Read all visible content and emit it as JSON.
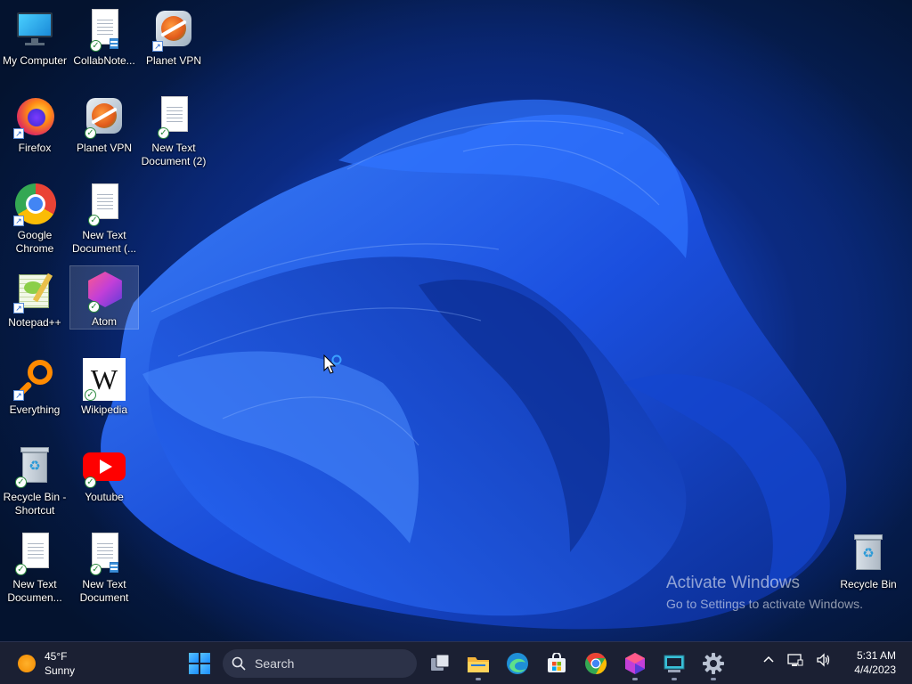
{
  "desktop": {
    "icons": [
      {
        "label": "My Computer"
      },
      {
        "label": "CollabNote..."
      },
      {
        "label": "Planet VPN"
      },
      {
        "label": "Firefox"
      },
      {
        "label": "Planet VPN"
      },
      {
        "label": "New Text Document (2)"
      },
      {
        "label": "Google Chrome"
      },
      {
        "label": "New Text Document (..."
      },
      {
        "label": "Notepad++"
      },
      {
        "label": "Atom"
      },
      {
        "label": "Everything"
      },
      {
        "label": "Wikipedia"
      },
      {
        "label": "Recycle Bin - Shortcut"
      },
      {
        "label": "Youtube"
      },
      {
        "label": "New Text Documen..."
      },
      {
        "label": "New Text Document"
      },
      {
        "label": "Recycle Bin"
      }
    ],
    "wikipedia_glyph": "W",
    "activate": {
      "title": "Activate Windows",
      "subtitle": "Go to Settings to activate Windows."
    }
  },
  "taskbar": {
    "weather": {
      "temp": "45°F",
      "condition": "Sunny"
    },
    "search": {
      "label": "Search"
    },
    "apps": [
      "task-view",
      "file-explorer",
      "edge",
      "microsoft-store",
      "chrome",
      "atom",
      "remote-desktop",
      "settings"
    ],
    "tray_icons": [
      "chevron-up-icon",
      "network-icon",
      "volume-icon"
    ],
    "clock": {
      "time": "5:31 AM",
      "date": "4/4/2023"
    }
  },
  "colors": {
    "accent": "#1a8cff",
    "taskbar_bg": "#1b2033",
    "wallpaper_blue": "#1c5cf0"
  }
}
